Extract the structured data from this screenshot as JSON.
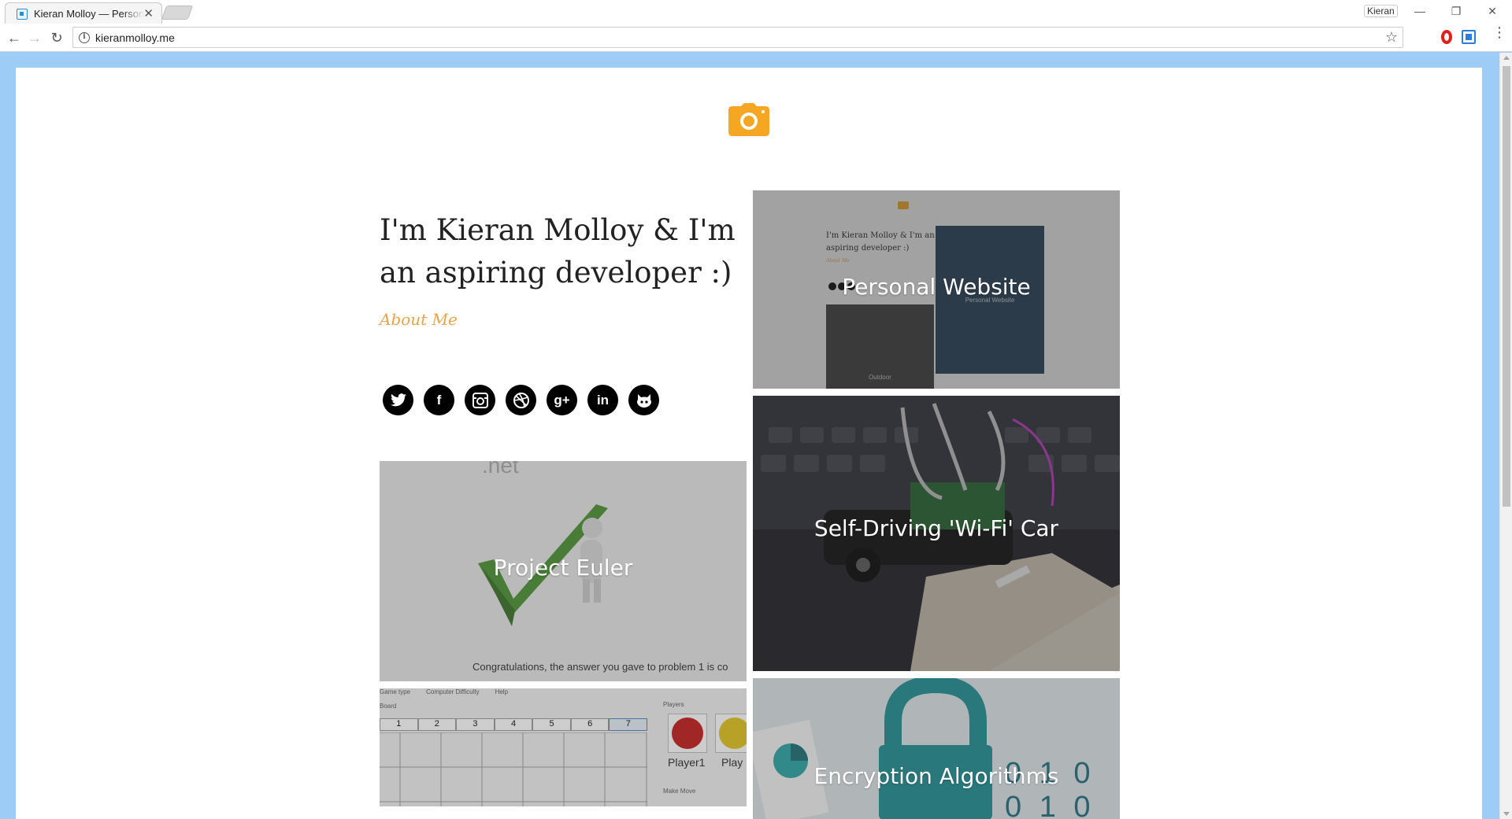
{
  "browser": {
    "tab_title": "Kieran Molloy — Personal",
    "tab_close": "✕",
    "profile_name": "Kieran",
    "url": "kieranmolloy.me",
    "window_controls": {
      "minimize": "—",
      "restore": "❐",
      "close": "✕"
    },
    "nav": {
      "back": "←",
      "forward": "→",
      "reload": "↻"
    },
    "info_glyph": "i",
    "star_glyph": "☆",
    "menu_glyph": "⋮"
  },
  "page": {
    "headline": "I'm Kieran Molloy & I'm an aspiring developer :)",
    "about_link": "About Me",
    "accent_color": "#e8a44c",
    "social": [
      {
        "name": "twitter",
        "glyph": "🐦"
      },
      {
        "name": "facebook",
        "glyph": "f"
      },
      {
        "name": "instagram",
        "glyph": "◙"
      },
      {
        "name": "dribbble",
        "glyph": "⊛"
      },
      {
        "name": "google-plus",
        "glyph": "g+"
      },
      {
        "name": "linkedin",
        "glyph": "in"
      },
      {
        "name": "github",
        "glyph": "☻"
      }
    ],
    "projects": {
      "personal_website": "Personal Website",
      "self_driving_car": "Self-Driving 'Wi-Fi' Car",
      "project_euler": "Project Euler",
      "connect_four": "",
      "encryption": "Encryption Algorithms"
    },
    "thumb_text": {
      "pw_heading": "I'm Kieran Molloy & I'm an aspiring developer :)",
      "pw_about": "About Me",
      "pw_caption_right": "Personal Website",
      "pw_caption_left": "Outdoor",
      "euler_banner": "Congratulations, the answer you gave to problem 1 is co",
      "euler_top": ".net",
      "c4_menu": [
        "Game type",
        "Computer Difficulty",
        "Help"
      ],
      "c4_board_label": "Board",
      "c4_columns": [
        "1",
        "2",
        "3",
        "4",
        "5",
        "6",
        "7"
      ],
      "c4_players_label": "Players",
      "c4_player1": "Player1",
      "c4_player2": "Play",
      "c4_make_move": "Make Move",
      "enc_binary": "0 1 0 0 1 0"
    }
  }
}
